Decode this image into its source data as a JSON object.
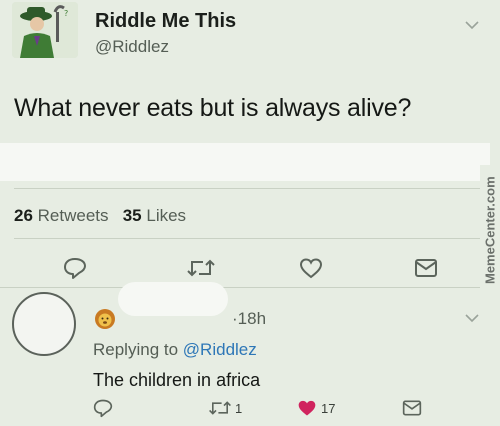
{
  "tweet": {
    "display_name": "Riddle Me This",
    "handle": "@Riddlez",
    "text": "What never eats but is always alive?",
    "retweets_count": "26",
    "retweets_label": "Retweets",
    "likes_count": "35",
    "likes_label": "Likes",
    "actions": [
      {
        "icon": "reply-icon"
      },
      {
        "icon": "retweet-icon"
      },
      {
        "icon": "like-icon"
      },
      {
        "icon": "message-icon"
      }
    ]
  },
  "reply": {
    "time": "18h",
    "replying_prefix": "Replying to",
    "replying_handle": "@Riddlez",
    "text": "The children in africa",
    "retweet_count": "1",
    "like_count": "17",
    "like_color": "#d0245e"
  },
  "watermark": "MemeCenter.com"
}
